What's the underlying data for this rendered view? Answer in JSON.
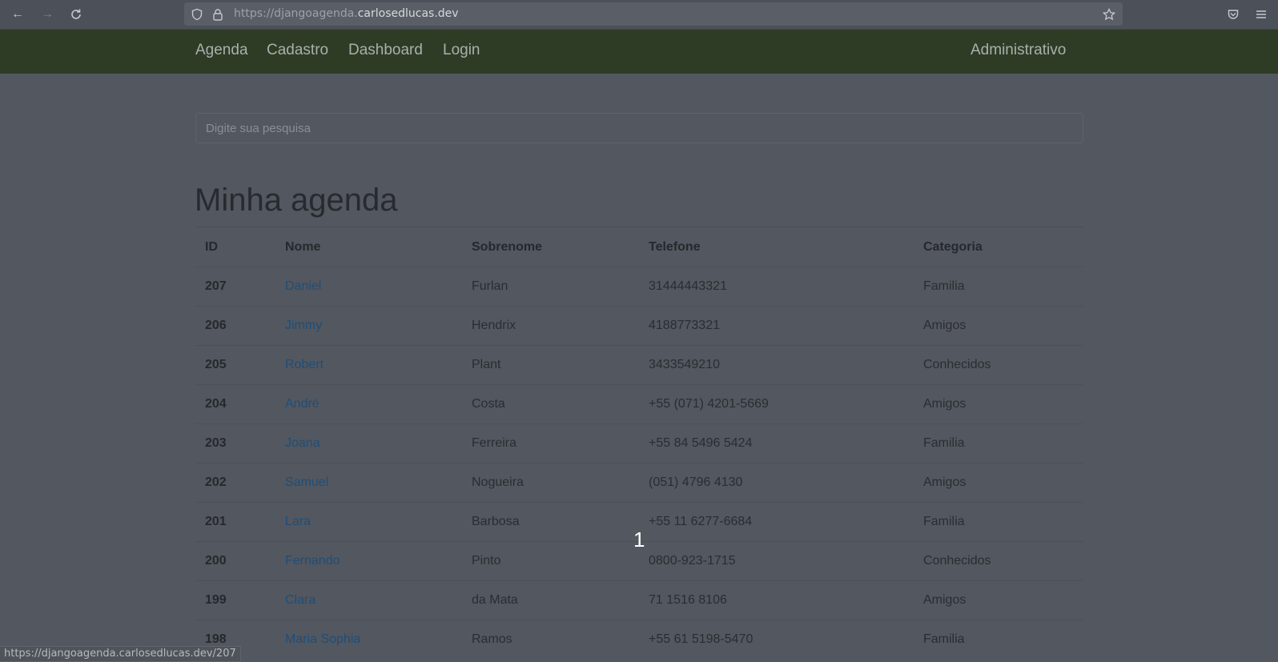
{
  "browser": {
    "url_prefix": "https://djangoagenda.",
    "url_host": "carlosedlucas.dev",
    "status_link": "https://djangoagenda.carlosedlucas.dev/207"
  },
  "navbar": {
    "links": [
      "Agenda",
      "Cadastro",
      "Dashboard",
      "Login"
    ],
    "admin": "Administrativo"
  },
  "search": {
    "placeholder": "Digite sua pesquisa"
  },
  "page_title": "Minha agenda",
  "table": {
    "headers": [
      "ID",
      "Nome",
      "Sobrenome",
      "Telefone",
      "Categoria"
    ],
    "rows": [
      [
        "207",
        "Daniel",
        "Furlan",
        "31444443321",
        "Familia"
      ],
      [
        "206",
        "Jimmy",
        "Hendrix",
        "4188773321",
        "Amigos"
      ],
      [
        "205",
        "Robert",
        "Plant",
        "3433549210",
        "Conhecidos"
      ],
      [
        "204",
        "André",
        "Costa",
        "+55 (071) 4201-5669",
        "Amigos"
      ],
      [
        "203",
        "Joana",
        "Ferreira",
        "+55 84 5496 5424",
        "Familia"
      ],
      [
        "202",
        "Samuel",
        "Nogueira",
        "(051) 4796 4130",
        "Amigos"
      ],
      [
        "201",
        "Lara",
        "Barbosa",
        "+55 11 6277-6684",
        "Familia"
      ],
      [
        "200",
        "Fernando",
        "Pinto",
        "0800-923-1715",
        "Conhecidos"
      ],
      [
        "199",
        "Clara",
        "da Mata",
        "71 1516 8106",
        "Amigos"
      ],
      [
        "198",
        "Maria Sophia",
        "Ramos",
        "+55 61 5198-5470",
        "Familia"
      ]
    ]
  },
  "overlay_number": "1",
  "colors": {
    "navbar": "#2e3c26",
    "link": "#1f4e78",
    "background": "#53575f"
  }
}
